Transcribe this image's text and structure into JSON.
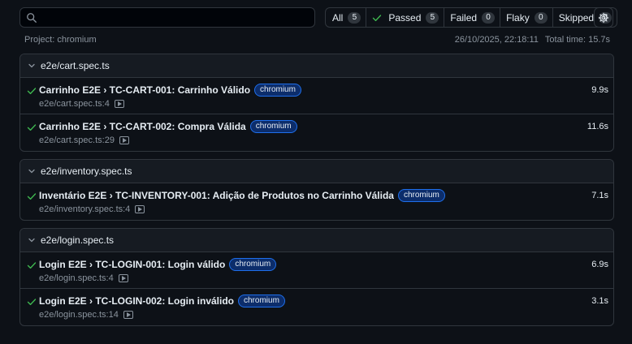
{
  "filters": [
    {
      "label": "All",
      "count": "5"
    },
    {
      "label": "Passed",
      "count": "5"
    },
    {
      "label": "Failed",
      "count": "0"
    },
    {
      "label": "Flaky",
      "count": "0"
    },
    {
      "label": "Skipped",
      "count": "0"
    }
  ],
  "project": "Project: chromium",
  "timestamp": "26/10/2025, 22:18:11",
  "total_time": "Total time: 15.7s",
  "groups": [
    {
      "file": "e2e/cart.spec.ts",
      "tests": [
        {
          "title": "Carrinho E2E › TC-CART-001: Carrinho Válido",
          "project": "chromium",
          "location": "e2e/cart.spec.ts:4",
          "duration": "9.9s"
        },
        {
          "title": "Carrinho E2E › TC-CART-002: Compra Válida",
          "project": "chromium",
          "location": "e2e/cart.spec.ts:29",
          "duration": "11.6s"
        }
      ]
    },
    {
      "file": "e2e/inventory.spec.ts",
      "tests": [
        {
          "title": "Inventário E2E › TC-INVENTORY-001: Adição de Produtos no Carrinho Válida",
          "project": "chromium",
          "location": "e2e/inventory.spec.ts:4",
          "duration": "7.1s"
        }
      ]
    },
    {
      "file": "e2e/login.spec.ts",
      "tests": [
        {
          "title": "Login E2E › TC-LOGIN-001: Login válido",
          "project": "chromium",
          "location": "e2e/login.spec.ts:4",
          "duration": "6.9s"
        },
        {
          "title": "Login E2E › TC-LOGIN-002: Login inválido",
          "project": "chromium",
          "location": "e2e/login.spec.ts:14",
          "duration": "3.1s"
        }
      ]
    }
  ],
  "colors": {
    "background": "#0d1117",
    "passed": "#3fb950",
    "badge_border": "#1f6feb"
  },
  "icons": {
    "search": "search-icon",
    "check": "check-icon",
    "settings": "gear-icon",
    "chevron": "chevron-down-icon",
    "trace": "play-icon"
  }
}
